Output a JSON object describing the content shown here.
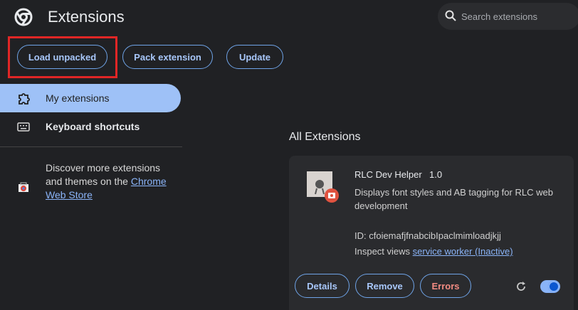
{
  "header": {
    "title": "Extensions",
    "search_placeholder": "Search extensions"
  },
  "toolbar": {
    "load_unpacked": "Load unpacked",
    "pack_extension": "Pack extension",
    "update": "Update"
  },
  "sidebar": {
    "items": [
      {
        "label": "My extensions",
        "icon": "extension-icon",
        "active": true
      },
      {
        "label": "Keyboard shortcuts",
        "icon": "keyboard-icon",
        "active": false
      }
    ],
    "discover_text": "Discover more extensions and themes on the",
    "store_link": "Chrome Web Store"
  },
  "main": {
    "section_title": "All Extensions",
    "extension": {
      "name": "RLC Dev Helper",
      "version": "1.0",
      "description": "Displays font styles and AB tagging for RLC web development",
      "id_line": "ID: cfoiemafjfnabcibIpaclmimloadjkjj",
      "inspect_label": "Inspect views",
      "inspect_link": "service worker (Inactive)",
      "buttons": {
        "details": "Details",
        "remove": "Remove",
        "errors": "Errors"
      },
      "enabled": true
    }
  },
  "colors": {
    "accent": "#8ab4f8",
    "highlight": "#e02626",
    "error": "#f28b82"
  }
}
